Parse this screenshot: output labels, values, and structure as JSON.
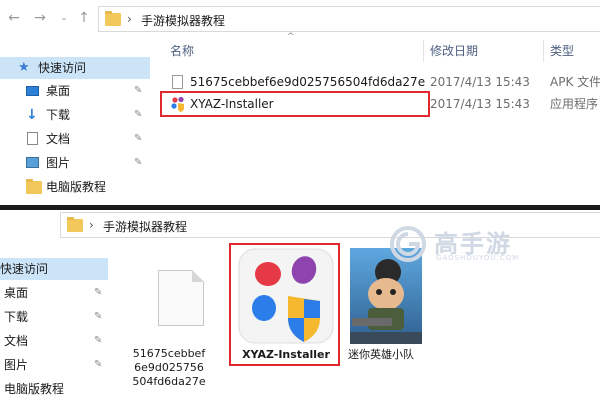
{
  "top_pane": {
    "address": {
      "path": "手游模拟器教程"
    },
    "sidebar": {
      "items": [
        {
          "label": "快速访问",
          "icon": "star-icon",
          "pinned": false
        },
        {
          "label": "桌面",
          "icon": "desktop-icon",
          "pinned": true
        },
        {
          "label": "下载",
          "icon": "download-icon",
          "pinned": true
        },
        {
          "label": "文档",
          "icon": "document-icon",
          "pinned": true
        },
        {
          "label": "图片",
          "icon": "pictures-icon",
          "pinned": true
        },
        {
          "label": "电脑版教程",
          "icon": "folder-icon",
          "pinned": false
        }
      ]
    },
    "columns": {
      "name": "名称",
      "date": "修改日期",
      "type": "类型"
    },
    "files": [
      {
        "name": "51675cebbef6e9d025756504fd6da27e",
        "date": "2017/4/13 15:43",
        "type": "APK 文件"
      },
      {
        "name": "XYAZ-Installer",
        "date": "2017/4/13 15:43",
        "type": "应用程序"
      }
    ]
  },
  "bottom_pane": {
    "address": {
      "path": "手游模拟器教程"
    },
    "sidebar": {
      "items": [
        {
          "label": "快速访问",
          "pinned": false
        },
        {
          "label": "桌面",
          "pinned": true
        },
        {
          "label": "下载",
          "pinned": true
        },
        {
          "label": "文档",
          "pinned": true
        },
        {
          "label": "图片",
          "pinned": true
        },
        {
          "label": "电脑版教程",
          "pinned": false
        }
      ]
    },
    "tiles": [
      {
        "label": "51675cebbef6e9d025756504fd6da27e",
        "icon": "blank-file-icon"
      },
      {
        "label": "XYAZ-Installer",
        "icon": "xyaz-app-icon"
      },
      {
        "label": "迷你英雄小队",
        "icon": "game-thumbnail"
      }
    ]
  },
  "watermark": {
    "brand": "高手游",
    "domain": "GAOSHOUYOU.COM"
  },
  "colors": {
    "highlight": "#e0282e",
    "selection": "#cce4f7",
    "column_header": "#4d6082"
  }
}
